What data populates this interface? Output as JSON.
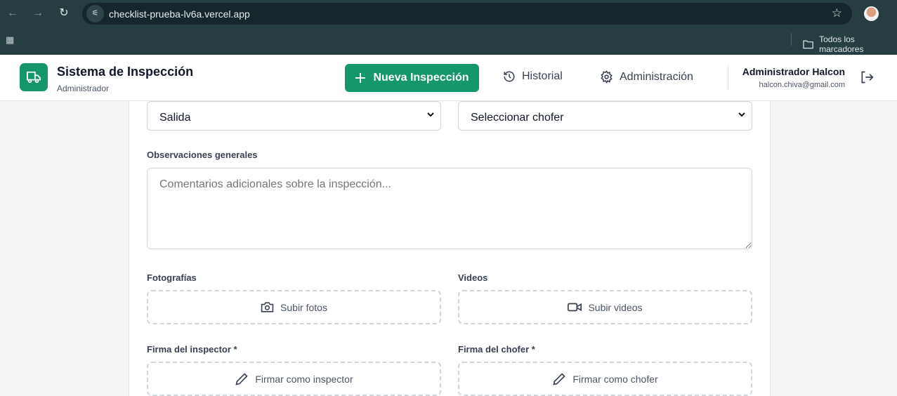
{
  "browser": {
    "url": "checklist-prueba-lv6a.vercel.app",
    "bookmarks_label": "Todos los marcadores"
  },
  "header": {
    "title": "Sistema de Inspección",
    "subtitle": "Administrador",
    "new_inspection": "Nueva Inspección",
    "history": "Historial",
    "admin": "Administración",
    "user_name": "Administrador Halcon",
    "user_email": "halcon.chiva@gmail.com"
  },
  "form": {
    "type_select": "Salida",
    "driver_select": "Seleccionar chofer",
    "observations_label": "Observaciones generales",
    "observations_placeholder": "Comentarios adicionales sobre la inspección...",
    "photos_label": "Fotografías",
    "photos_button": "Subir fotos",
    "videos_label": "Videos",
    "videos_button": "Subir videos",
    "inspector_sig_label": "Firma del inspector *",
    "inspector_sig_button": "Firmar como inspector",
    "driver_sig_label": "Firma del chofer *",
    "driver_sig_button": "Firmar como chofer"
  },
  "colors": {
    "accent": "#15966b",
    "chrome": "#263d42"
  }
}
